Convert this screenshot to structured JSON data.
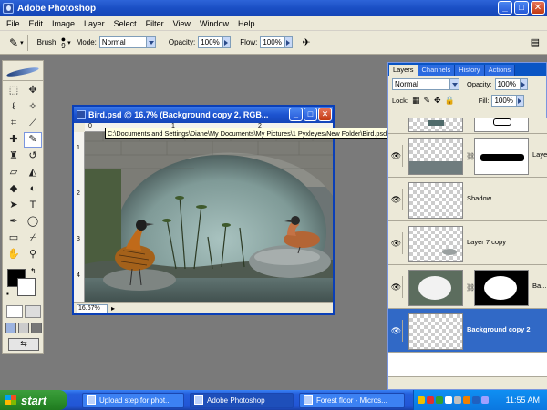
{
  "app": {
    "title": "Adobe Photoshop",
    "window_buttons": [
      "_",
      "□",
      "✕"
    ]
  },
  "menu": [
    "File",
    "Edit",
    "Image",
    "Layer",
    "Select",
    "Filter",
    "View",
    "Window",
    "Help"
  ],
  "options": {
    "brush_label": "Brush:",
    "brush_size": "9",
    "mode_label": "Mode:",
    "mode_value": "Normal",
    "opacity_label": "Opacity:",
    "opacity_value": "100%",
    "flow_label": "Flow:",
    "flow_value": "100%"
  },
  "document": {
    "title": "Bird.psd @ 16.7% (Background copy 2, RGB...",
    "zoom": "16.67%",
    "ruler_v": [
      "1",
      "2",
      "3",
      "4"
    ],
    "ruler_h": [
      "0",
      "1",
      "2"
    ]
  },
  "tooltip": "C:\\Documents and Settings\\Diane\\My Documents\\My Pictures\\1 Pyxleyes\\New Folder\\Bird.psd @ 16.7% (Background copy 2, RGB/8)",
  "layers_panel": {
    "tabs": [
      "Layers",
      "Channels",
      "History",
      "Actions"
    ],
    "blend_mode": "Normal",
    "opacity_label": "Opacity:",
    "opacity_value": "100%",
    "lock_label": "Lock:",
    "fill_label": "Fill:",
    "fill_value": "100%",
    "layers": [
      {
        "name": ""
      },
      {
        "name": "Layer"
      },
      {
        "name": "Shadow"
      },
      {
        "name": "Layer 7 copy"
      },
      {
        "name": "Ba..."
      },
      {
        "name": "Background copy 2"
      }
    ]
  },
  "taskbar": {
    "start": "start",
    "tasks": [
      "Upload step for phot...",
      "Adobe Photoshop",
      "Forest floor - Micros..."
    ],
    "clock": "11:55 AM"
  },
  "colors": {
    "xp_blue": "#245edb",
    "selection": "#3169c6",
    "start_green": "#2d8f2d"
  }
}
